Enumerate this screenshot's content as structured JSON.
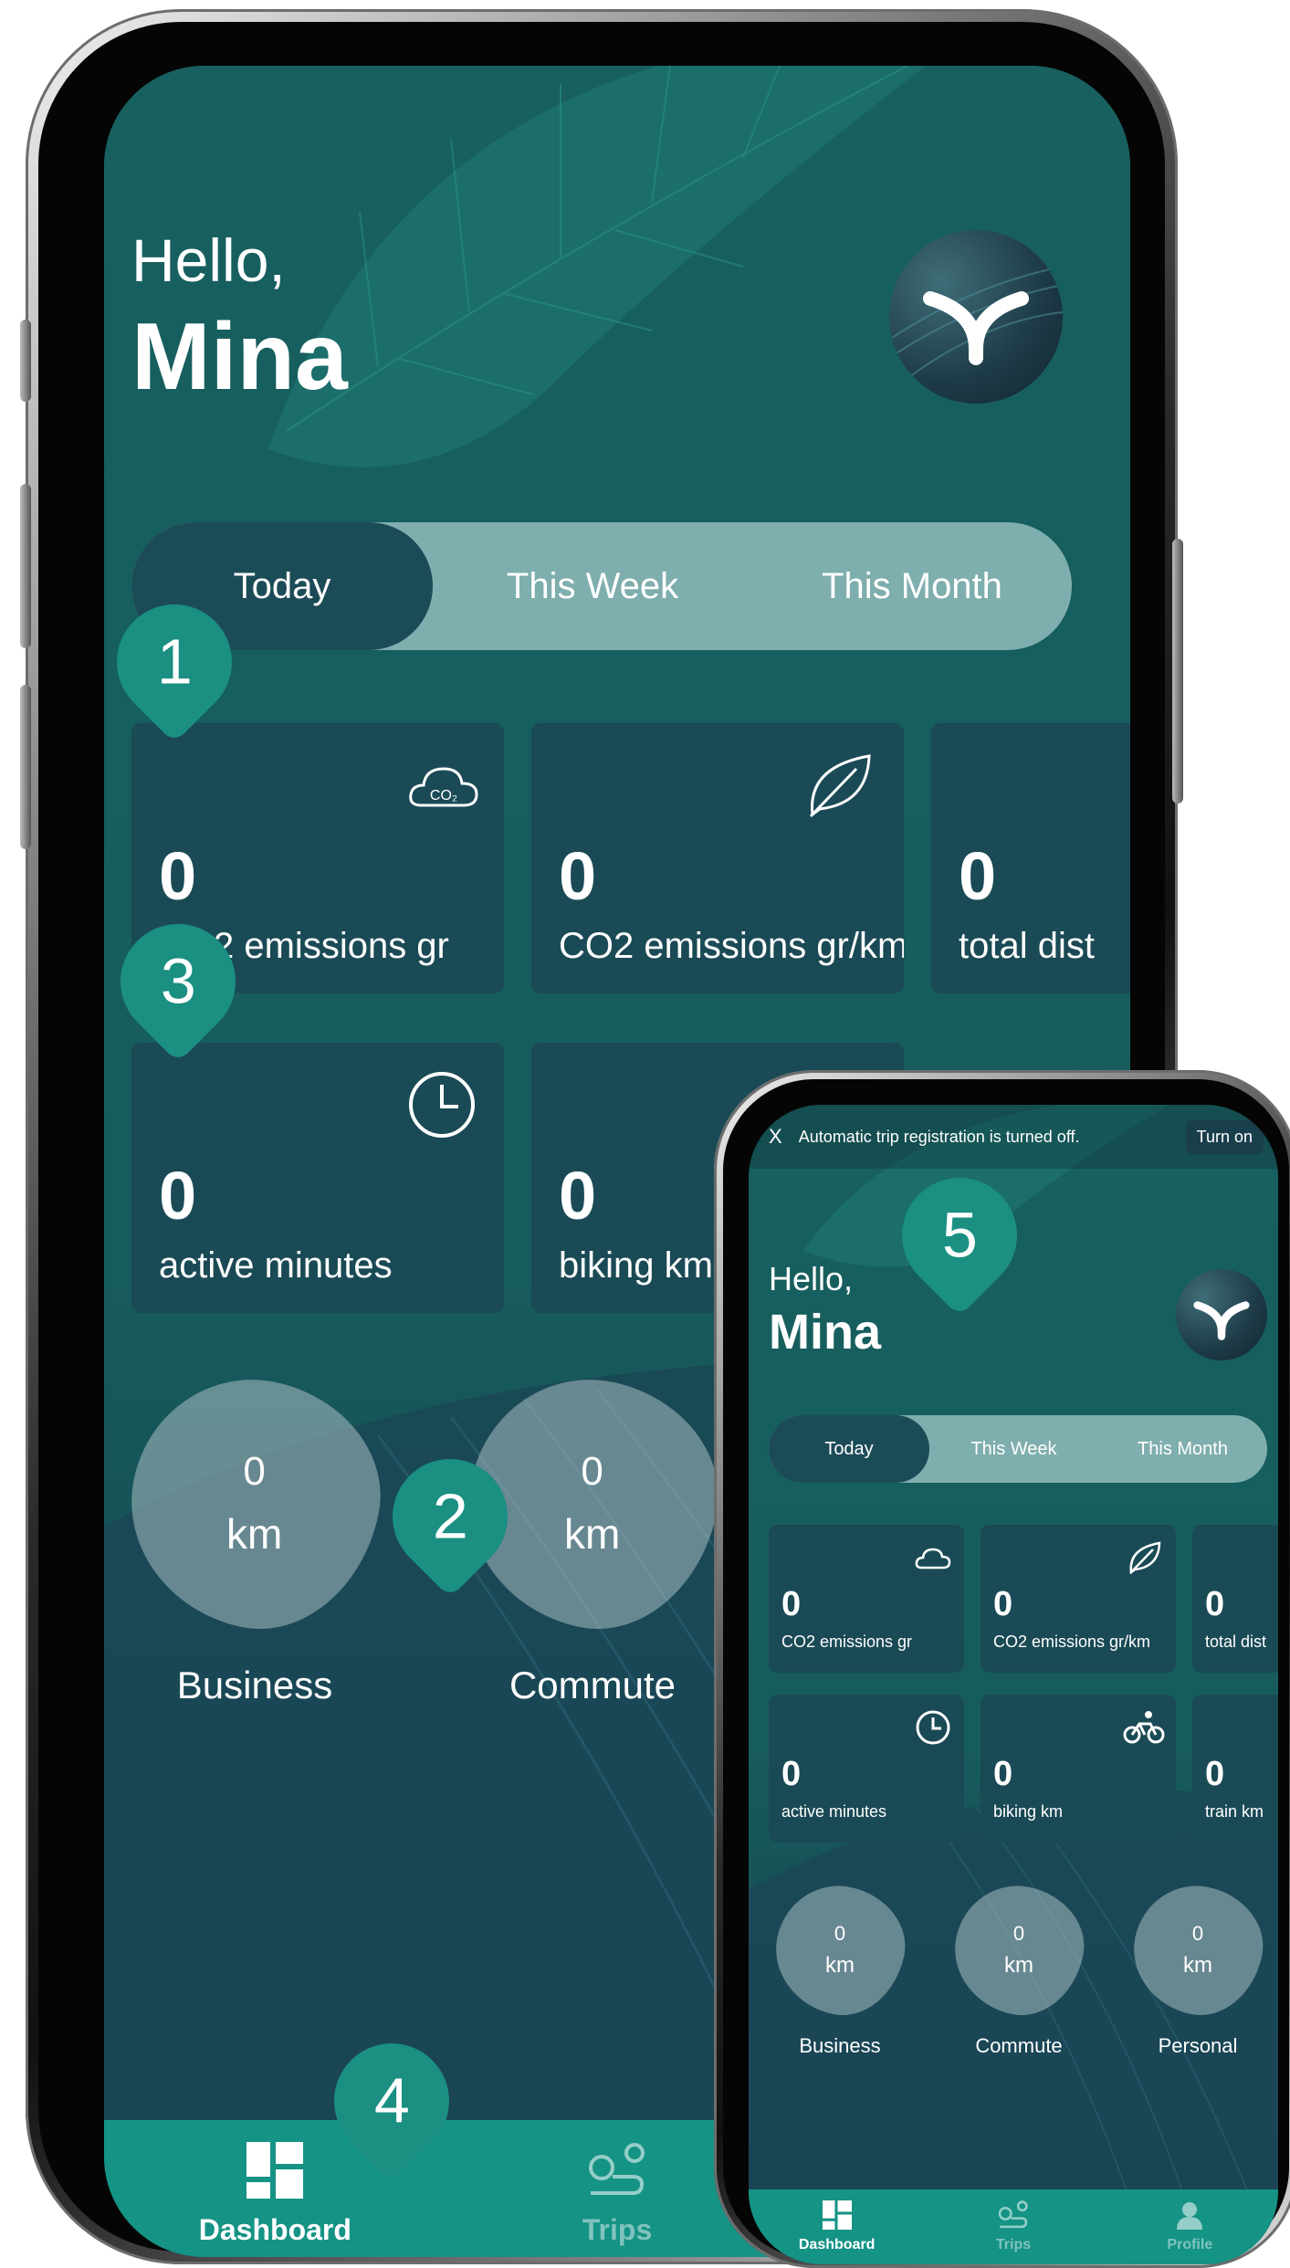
{
  "colors": {
    "screen_bg": "#16575a",
    "card_bg": "#1a4a55",
    "accent_teal": "#159385",
    "badge_bg": "#1a8f82",
    "tab_track": "#7faeae",
    "tab_active": "#1b4b57"
  },
  "big": {
    "greeting": "Hello,",
    "name": "Mina",
    "tabs": [
      "Today",
      "This Week",
      "This Month"
    ],
    "cards": [
      {
        "value": "0",
        "label": "CO2 emissions gr",
        "icon": "co2-cloud-icon"
      },
      {
        "value": "0",
        "label": "CO2 emissions gr/km",
        "icon": "leaf-icon"
      },
      {
        "value": "0",
        "label": "total dist",
        "icon": ""
      },
      {
        "value": "0",
        "label": "active minutes",
        "icon": "clock-icon"
      },
      {
        "value": "0",
        "label": "biking km",
        "icon": "bike-icon"
      }
    ],
    "blobs": [
      {
        "value": "0",
        "unit": "km",
        "label": "Business"
      },
      {
        "value": "0",
        "unit": "km",
        "label": "Commute"
      }
    ],
    "nav": [
      "Dashboard",
      "Trips"
    ]
  },
  "small": {
    "banner": {
      "close": "X",
      "message": "Automatic trip registration is turned off.",
      "button": "Turn on"
    },
    "greeting": "Hello,",
    "name": "Mina",
    "tabs": [
      "Today",
      "This Week",
      "This Month"
    ],
    "cards": [
      {
        "value": "0",
        "label": "CO2 emissions gr",
        "icon": "co2-cloud-icon"
      },
      {
        "value": "0",
        "label": "CO2 emissions gr/km",
        "icon": "leaf-icon"
      },
      {
        "value": "0",
        "label": "total dist",
        "icon": ""
      },
      {
        "value": "0",
        "label": "active minutes",
        "icon": "clock-icon"
      },
      {
        "value": "0",
        "label": "biking km",
        "icon": "bike-icon"
      },
      {
        "value": "0",
        "label": "train km",
        "icon": ""
      }
    ],
    "blobs": [
      {
        "value": "0",
        "unit": "km",
        "label": "Business"
      },
      {
        "value": "0",
        "unit": "km",
        "label": "Commute"
      },
      {
        "value": "0",
        "unit": "km",
        "label": "Personal"
      }
    ],
    "nav": [
      "Dashboard",
      "Trips",
      "Profile"
    ]
  },
  "badges": [
    "1",
    "2",
    "3",
    "4",
    "5"
  ]
}
